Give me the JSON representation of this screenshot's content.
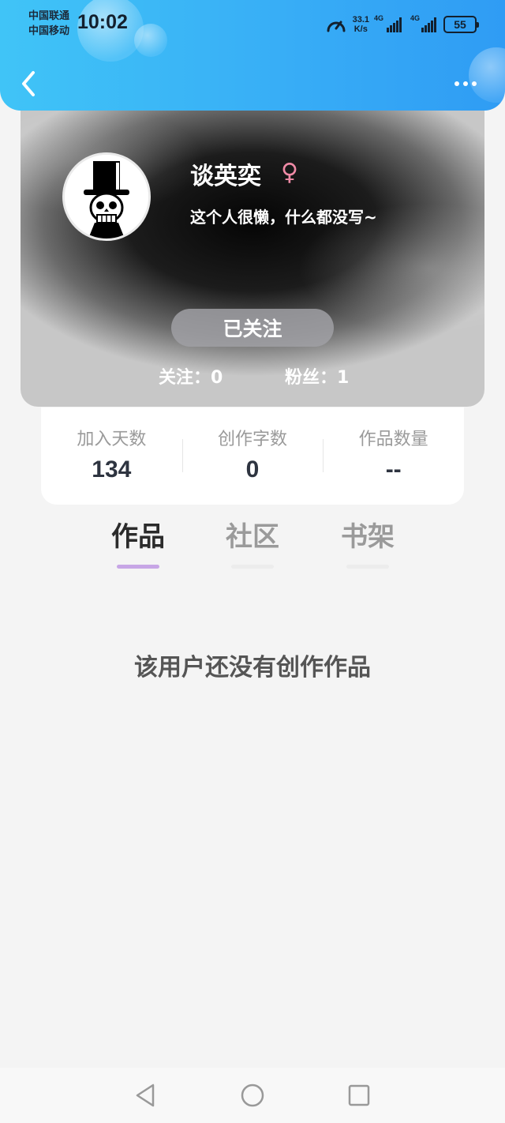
{
  "status_bar": {
    "carrier_1": "中国联通",
    "carrier_2": "中国移动",
    "time": "10:02",
    "net_speed_value": "33.1",
    "net_speed_unit": "K/s",
    "net_type_1": "4G",
    "net_type_2": "4G",
    "battery": "55"
  },
  "header": {
    "back_icon": "chevron-left-icon",
    "more_icon": "more-dots-icon"
  },
  "profile": {
    "username": "谈英奕",
    "gender_symbol": "♀",
    "bio": "这个人很懒，什么都没写~",
    "follow_button": "已关注",
    "following_label": "关注：0",
    "followers_label": "粉丝：1"
  },
  "stats": [
    {
      "label": "加入天数",
      "value": "134"
    },
    {
      "label": "创作字数",
      "value": "0"
    },
    {
      "label": "作品数量",
      "value": "--"
    }
  ],
  "tabs": [
    {
      "label": "作品",
      "active": true
    },
    {
      "label": "社区",
      "active": false
    },
    {
      "label": "书架",
      "active": false
    }
  ],
  "empty_message": "该用户还没有创作作品",
  "nav": {
    "back": "triangle-back-icon",
    "home": "circle-home-icon",
    "recents": "square-recents-icon"
  },
  "colors": {
    "header_start": "#40c4f7",
    "header_end": "#2f9cf4",
    "active_tab_underline": "#c7a6e6",
    "gender": "#f08aa6"
  }
}
